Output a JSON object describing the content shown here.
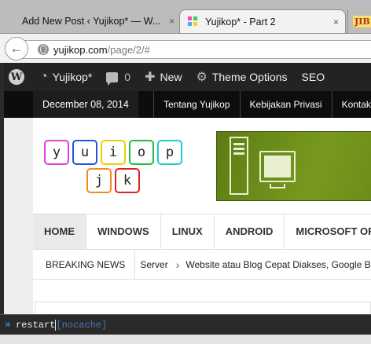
{
  "tabs": [
    {
      "label": "Add New Post ‹ Yujikop* — W...",
      "active": false
    },
    {
      "label": "Yujikop* - Part 2",
      "active": true
    },
    {
      "label": "JIB",
      "active": false
    }
  ],
  "tab_close_glyph": "×",
  "navbar": {
    "url_host": "yujikop.com",
    "url_path": "/page/2/#"
  },
  "adminbar": {
    "site_name": "Yujikop*",
    "comments_count": "0",
    "new_label": "New",
    "theme_options_label": "Theme Options",
    "seo_label": "SEO"
  },
  "topbar": {
    "date": "December 08, 2014",
    "links": [
      "Tentang Yujikop",
      "Kebijakan Privasi",
      "Kontak Kami"
    ]
  },
  "logo": {
    "letters": [
      {
        "char": "y",
        "color": "#e040e0"
      },
      {
        "char": "u",
        "color": "#2255dd"
      },
      {
        "char": "i",
        "color": "#e8d000"
      },
      {
        "char": "o",
        "color": "#22bb44"
      },
      {
        "char": "p",
        "color": "#22cccc"
      },
      {
        "char": "j",
        "color": "#f08c1e"
      },
      {
        "char": "k",
        "color": "#dd2222"
      }
    ]
  },
  "menu": {
    "items": [
      "HOME",
      "WINDOWS",
      "LINUX",
      "ANDROID",
      "MICROSOFT OFFICE"
    ]
  },
  "breaking": {
    "label": "BREAKING NEWS",
    "item1": "Server",
    "item2": "Website atau Blog Cepat Diakses, Google Berikan Peringkat Tinggi"
  },
  "cmdbar": {
    "prompt": "»",
    "text": "restart",
    "suffix": "[nocache]"
  },
  "colors": {
    "admin_bar": "#232323",
    "top_bar": "#0d0d0d",
    "banner_green": "#6b8b19",
    "command_prompt": "#4aa3ff"
  }
}
